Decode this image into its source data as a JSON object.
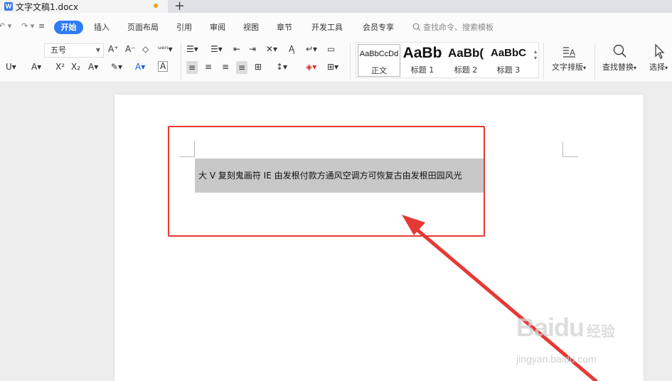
{
  "tab": {
    "title": "文字文稿1.docx",
    "icon_letter": "W",
    "new_tab": "+"
  },
  "menu": {
    "undo": "↶ ▾",
    "redo": "↷ ▾",
    "more": "≡",
    "items": [
      "开始",
      "插入",
      "页面布局",
      "引用",
      "审阅",
      "视图",
      "章节",
      "开发工具",
      "会员专享"
    ],
    "search_placeholder": "查找命令、搜索模板"
  },
  "ribbon": {
    "font_size": "五号",
    "font_tools_row1": [
      "A⁺",
      "A⁻",
      "◇",
      "ᵘᵉⁿ▾"
    ],
    "font_tools_row2": [
      "U▾",
      "A▾",
      "X²",
      "X₂",
      "A▾",
      "✎▾",
      "A▾",
      "A"
    ],
    "para_row1": [
      "☰▾",
      "☰▾",
      "⇤",
      "⇥",
      "✕▾",
      "Ą",
      "↵▾",
      "▭"
    ],
    "para_row2": [
      "≡",
      "≡",
      "≡",
      "≡",
      "⊞",
      "↕▾",
      "◈▾",
      "⊞▾"
    ],
    "styles": [
      {
        "sample": "AaBbCcDd",
        "name": "正文"
      },
      {
        "sample": "AaBb",
        "name": "标题 1"
      },
      {
        "sample": "AaBb(",
        "name": "标题 2"
      },
      {
        "sample": "AaBbC",
        "name": "标题 3"
      }
    ],
    "buttons": {
      "text_layout": "文字排版",
      "find_replace": "查找替换",
      "select": "选择"
    }
  },
  "document": {
    "selected_text": "大 V 复刻鬼画符 IE 由发根付款方通风空调方可恢复古由发根田园风光"
  },
  "watermark": {
    "brand": "Baidu",
    "sub": "经验",
    "url": "jingyan.baidu.com"
  },
  "colors": {
    "accent": "#2f7bf5",
    "annotation": "#e53935",
    "selection": "#c8c8c8"
  }
}
